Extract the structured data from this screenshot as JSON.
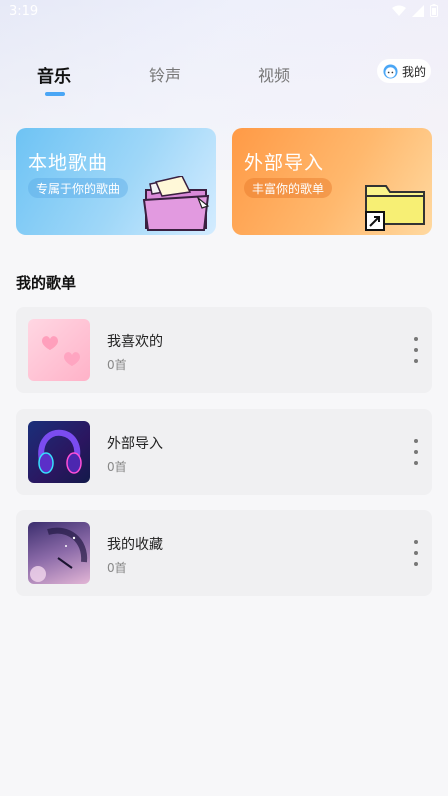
{
  "status": {
    "time": "3:19"
  },
  "tabs": [
    {
      "label": "音乐",
      "active": true
    },
    {
      "label": "铃声",
      "active": false
    },
    {
      "label": "视频",
      "active": false
    }
  ],
  "mine": {
    "label": "我的"
  },
  "cards": {
    "local": {
      "title": "本地歌曲",
      "subtitle": "专属于你的歌曲"
    },
    "import": {
      "title": "外部导入",
      "subtitle": "丰富你的歌单"
    }
  },
  "section_title": "我的歌单",
  "playlists": [
    {
      "name": "我喜欢的",
      "count": "0首"
    },
    {
      "name": "外部导入",
      "count": "0首"
    },
    {
      "name": "我的收藏",
      "count": "0首"
    }
  ],
  "colors": {
    "accent": "#4aa6f5",
    "local_card": "#6ec3f4",
    "import_card": "#ff9a46"
  }
}
